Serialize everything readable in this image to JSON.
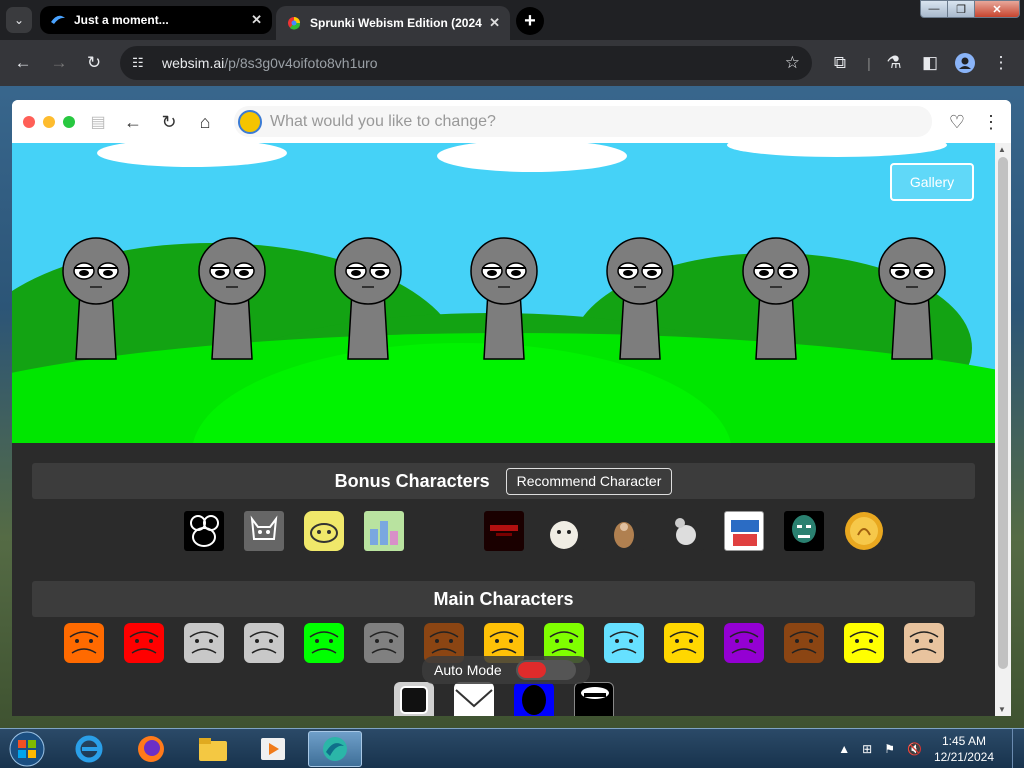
{
  "browser": {
    "tabs": [
      {
        "title": "Just a moment...",
        "active": false
      },
      {
        "title": "Sprunki Webism Edition (2024",
        "active": true
      }
    ],
    "url_host": "websim.ai",
    "url_path": "/p/8s3g0v4oifoto8vh1uro",
    "icons": {
      "tab_search": "chevron-down-icon",
      "new_tab": "plus-icon",
      "back": "arrow-left-icon",
      "forward": "arrow-right-icon",
      "reload": "reload-icon",
      "site_info": "tune-icon",
      "bookmark": "star-icon",
      "extensions": "puzzle-icon",
      "labs": "flask-icon",
      "side_panel": "sidepanel-icon",
      "profile": "profile-icon",
      "menu": "kebab-menu-icon"
    }
  },
  "websim": {
    "prompt_placeholder": "What would you like to change?"
  },
  "game": {
    "gallery_label": "Gallery",
    "character_count": 7,
    "bonus_title": "Bonus Characters",
    "recommend_label": "Recommend Character",
    "main_title": "Main Characters",
    "auto_mode_label": "Auto Mode",
    "auto_mode_on": false,
    "bonus_count": 11,
    "main_colors": [
      "#ff6a00",
      "#ff0000",
      "#c8c8c8",
      "#c8c8c8",
      "#00ff00",
      "#808080",
      "#8b4513",
      "#ffc107",
      "#7fff00",
      "#66e0ff",
      "#ffd700",
      "#9400d3",
      "#8b4513",
      "#ffff00",
      "#e8c39e"
    ],
    "row3_colors": [
      "#ffffff",
      "#ffffff",
      "#0000ff",
      "#000000"
    ]
  },
  "taskbar": {
    "time": "1:45 AM",
    "date": "12/21/2024"
  }
}
